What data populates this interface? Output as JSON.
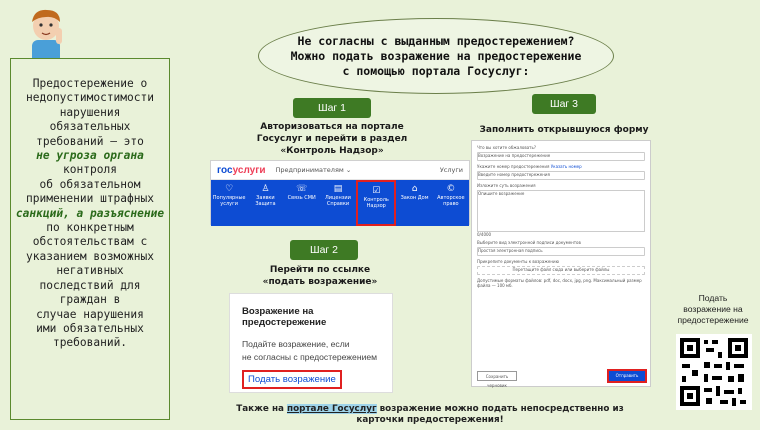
{
  "question": {
    "lines": [
      "Не согласны с выданным предостережением?",
      "Можно подать возражение на предостережение",
      "с помощью портала Госуслуг:"
    ]
  },
  "left_panel": {
    "lines": [
      "Предостережение о",
      "недопустимостимости",
      "нарушения",
      "обязательных",
      "требований – это",
      "не угроза органа",
      "контроля",
      "об обязательном",
      "применении штрафных",
      "санкций, а разъяснение",
      "по конкретным",
      "обстоятельствам с",
      "указанием возможных",
      "негативных",
      "последствий для",
      "граждан в",
      "случае нарушения",
      "ими обязательных",
      "требований."
    ]
  },
  "step1": {
    "label": "Шаг 1",
    "lines": [
      "Авторизоваться на портале",
      "Госуслуг и перейти в раздел",
      "«Контроль Надзор»"
    ]
  },
  "step2": {
    "label": "Шаг 2",
    "lines": [
      "Перейти по ссылке",
      "«подать возражение»"
    ]
  },
  "step3": {
    "label": "Шаг 3",
    "text": "Заполнить открывшуюся форму"
  },
  "gosuslugi": {
    "logo_a": "гос",
    "logo_b": "услуги",
    "menu": "Предпринимателям ⌄",
    "services": "Услуги",
    "nav": [
      {
        "icon": "heart-icon",
        "glyph": "♡",
        "label": [
          "Популярные",
          "услуги"
        ]
      },
      {
        "icon": "person-icon",
        "glyph": "♙",
        "label": [
          "Заявки",
          "Защита"
        ]
      },
      {
        "icon": "phone-icon",
        "glyph": "☏",
        "label": [
          "Связь СМИ",
          ""
        ]
      },
      {
        "icon": "document-icon",
        "glyph": "▤",
        "label": [
          "Лицензии",
          "Справки"
        ]
      },
      {
        "icon": "clipboard-icon",
        "glyph": "☑",
        "label": [
          "Контроль",
          "Надзор"
        ]
      },
      {
        "icon": "home-icon",
        "glyph": "⌂",
        "label": [
          "Закон Дом",
          ""
        ]
      },
      {
        "icon": "copyright-icon",
        "glyph": "©",
        "label": [
          "Авторское",
          "право"
        ]
      }
    ]
  },
  "objection_card": {
    "title": "Возражение на предостережение",
    "desc": [
      "Подайте возражение, если",
      "не согласны с предостережением"
    ],
    "link": "Подать возражение"
  },
  "form": {
    "q1": "Что вы хотите обжаловать?",
    "q1_placeholder": "Возражение на предостережение",
    "q2": "Укажите номер предостережения",
    "q2_link": "Указать номер",
    "q2_placeholder": "Введите номер предостережения",
    "q3": "Изложите суть возражения",
    "q3_placeholder": "Опишите возражение",
    "counter": "0/4000",
    "q4": "Выберите вид электронной подписи документов",
    "q4_placeholder": "Простая электронная подпись",
    "q5": "Прикрепите документы к возражению",
    "q5_drop": "Перетащите файл сюда или выберите файлы",
    "hint": "Допустимые форматы файлов: pdf, doc, docx, jpg, png. Максимальный размер файла — 100 мб.",
    "save": "Сохранить черновик",
    "submit": "Отправить"
  },
  "qr_label": [
    "Подать",
    "возражение на",
    "предостережение"
  ],
  "bottom": {
    "a": "Также на ",
    "b": "портале Госуслуг",
    "c": " возражение можно подать непосредственно из",
    "d": "карточки предостережения!"
  }
}
